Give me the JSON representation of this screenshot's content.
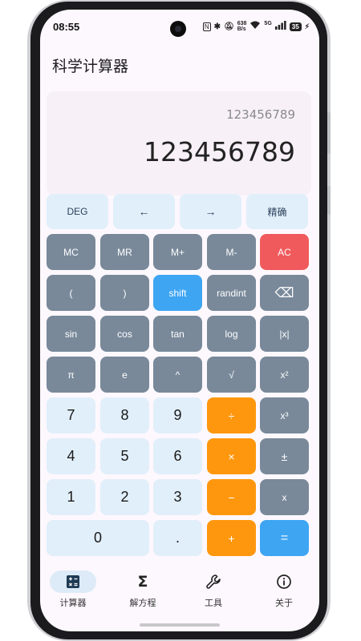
{
  "status_bar": {
    "time": "08:55",
    "net_speed_value": "638",
    "net_speed_unit": "B/s",
    "wifi_badge": "5G",
    "battery": "35"
  },
  "app": {
    "title": "科学计算器"
  },
  "display": {
    "expression": "123456789",
    "result": "123456789"
  },
  "mode_row": [
    {
      "label": "DEG"
    },
    {
      "label": "←"
    },
    {
      "label": "→"
    },
    {
      "label": "精确"
    }
  ],
  "keys": {
    "mc": "MC",
    "mr": "MR",
    "mplus": "M+",
    "mminus": "M-",
    "ac": "AC",
    "lparen": "(",
    "rparen": ")",
    "shift": "shift",
    "randint": "randint",
    "backspace": "⌫",
    "sin": "sin",
    "cos": "cos",
    "tan": "tan",
    "log": "log",
    "abs": "|x|",
    "pi": "π",
    "e": "e",
    "pow": "^",
    "sqrt": "√",
    "square": "x²",
    "n7": "7",
    "n8": "8",
    "n9": "9",
    "div": "÷",
    "cube": "x³",
    "n4": "4",
    "n5": "5",
    "n6": "6",
    "mul": "×",
    "plusminus": "±",
    "n1": "1",
    "n2": "2",
    "n3": "3",
    "sub": "−",
    "x": "x",
    "n0": "0",
    "dot": ".",
    "add": "+",
    "eq": "="
  },
  "nav": [
    {
      "label": "计算器",
      "icon": "calculator-icon",
      "active": true
    },
    {
      "label": "解方程",
      "icon": "sigma-icon"
    },
    {
      "label": "工具",
      "icon": "wrench-icon"
    },
    {
      "label": "关于",
      "icon": "info-icon"
    }
  ],
  "colors": {
    "mode_bg": "#e1effa",
    "grey_key": "#79899a",
    "ac_red": "#f05a5c",
    "shift_blue": "#3ea5f3",
    "operator_orange": "#ff970e",
    "number_bg": "#e1effa",
    "screen_bg": "#fdf8fd"
  }
}
